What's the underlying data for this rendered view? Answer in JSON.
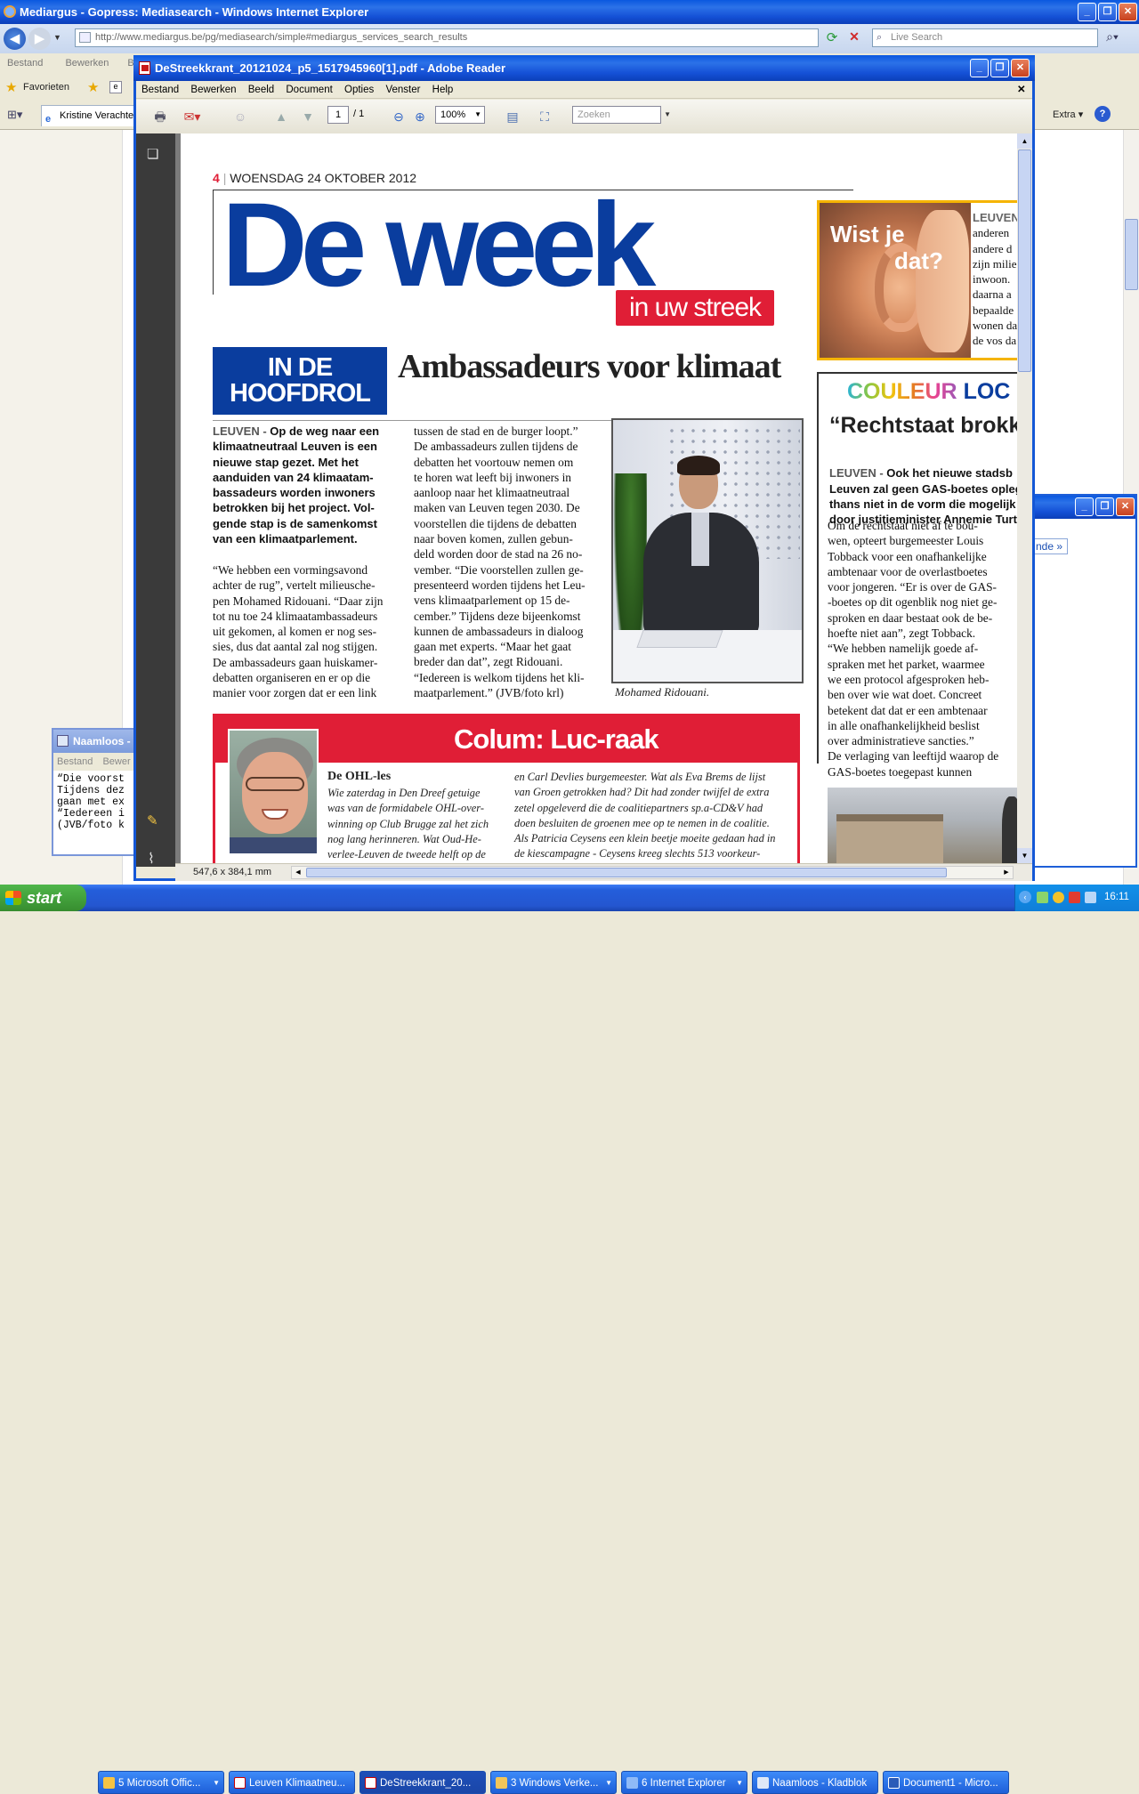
{
  "ie": {
    "title": "Mediargus - Gopress: Mediasearch - Windows Internet Explorer",
    "url": "http://www.mediargus.be/pg/mediasearch/simple#mediargus_services_search_results",
    "url_host": "www.mediargus.be",
    "search_placeholder": "Live Search",
    "menu": [
      "Bestand",
      "Bewerken",
      "Beel"
    ],
    "favorites_label": "Favorieten",
    "tab_label": "Kristine Verachter",
    "extra_label": "Extra",
    "side_link": "nde »"
  },
  "notepad": {
    "title": "Naamloos - ...",
    "menu": [
      "Bestand",
      "Bewer"
    ],
    "lines": [
      "“Die voorst",
      "Tijdens dez",
      "gaan met ex",
      "“Iedereen i",
      "(JVB/foto k"
    ]
  },
  "reader": {
    "title": "DeStreekkrant_20121024_p5_1517945960[1].pdf - Adobe Reader",
    "menu": [
      "Bestand",
      "Bewerken",
      "Beeld",
      "Document",
      "Opties",
      "Venster",
      "Help"
    ],
    "page_current": "1",
    "page_total": "/ 1",
    "zoom": "100%",
    "search_placeholder": "Zoeken",
    "status_size": "547,6 x 384,1 mm"
  },
  "newspaper": {
    "page_num": "4",
    "date": "WOENSDAG 24 OKTOBER 2012",
    "masthead": "De week",
    "masthead_sub": "in uw streek",
    "wist_title_1": "Wist je",
    "wist_title_2": "dat?",
    "wist_lines": [
      "LEUVEN",
      "anderen",
      "andere d",
      "zijn milie",
      "inwoon.",
      "daarna a",
      "bepaalde",
      "wonen da",
      "de vos da"
    ],
    "hoofdrol_1": "IN DE",
    "hoofdrol_2": "HOOFDROL",
    "headline": "Ambassadeurs voor klimaat",
    "lead_city": "LEUVEN -",
    "lead": "Op de weg naar een\nklimaatneutraal Leuven is een\nnieuwe stap gezet. Met het\naanduiden van 24 klimaatam-\nbassadeurs worden inwoners\nbetrokken bij het project. Vol-\ngende stap is de samenkomst\nvan een klimaatparlement.",
    "col1": "“We hebben een vormingsavond\nachter de rug”, vertelt milieusche-\npen Mohamed Ridouani. “Daar zijn\ntot nu toe 24 klimaatambassadeurs\nuit gekomen, al komen er nog ses-\nsies, dus dat aantal zal nog stijgen.\nDe ambassadeurs gaan huiskamer-\ndebatten organiseren en er op die\nmanier voor zorgen dat er een link",
    "col2": "tussen de stad en de burger loopt.”\nDe ambassadeurs zullen tijdens de\ndebatten het voortouw nemen om\nte horen wat leeft bij inwoners in\naanloop naar het klimaatneutraal\nmaken van Leuven tegen 2030. De\nvoorstellen die tijdens de debatten\nnaar boven komen, zullen gebun-\ndeld worden door de stad na 26 no-\nvember. “Die voorstellen zullen ge-\npresenteerd worden tijdens het Leu-\nvens klimaatparlement op 15 de-\ncember.” Tijdens deze bijeenkomst\nkunnen de ambassadeurs in dialoog\ngaan met experts. “Maar het gaat\nbreder dan dat”, zegt Ridouani.\n“Iedereen is welkom tijdens het kli-\nmaatparlement.” (JVB/foto krl)",
    "photo_caption": "Mohamed Ridouani.",
    "couleur_a": "COULEUR",
    "couleur_b": "LOC",
    "couleur_headline": "“Rechtstaat brokk",
    "couleur_lead_city": "LEUVEN -",
    "couleur_lead": "Ook het nieuwe stadsb\nLeuven zal geen GAS-boetes opleg\nthans niet in de vorm die mogelijk\ndoor justitieminister Annemie Turt",
    "couleur_body": "Om de rechtstaat niet af te bou-\nwen, opteert burgemeester Louis\nTobback voor een onafhankelijke\nambtenaar voor de overlastboetes\nvoor jongeren. “Er is over de GAS-\n-boetes op dit ogenblik nog niet ge-\nsproken en daar bestaat ook de be-\nhoefte niet aan”, zegt Tobback.\n“We hebben namelijk goede af-\nspraken met het parket, waarmee\nwe een protocol afgesproken heb-\nben over wie wat doet. Concreet\nbetekent dat dat er een ambtenaar\nin alle onafhankelijkheid beslist\nover administratieve sancties.”\nDe verlaging van leeftijd waarop de\nGAS-boetes toegepast kunnen",
    "colum_title": "Colum: Luc-raak",
    "colum_sub": "De OHL-les",
    "colum_c1": "Wie zaterdag in Den Dreef getuige\nwas van de formidabele OHL-over-\nwinning op Club Brugge zal het zich\nnog lang herinneren. Wat Oud-He-\nverlee-Leuven de tweede helft op de",
    "colum_c2": "en Carl Devlies burgemeester. Wat als Eva Brems de lijst\nvan Groen getrokken had? Dit had zonder twijfel de extra\nzetel opgeleverd die de coalitiepartners sp.a-CD&V had\ndoen besluiten de groenen mee op te nemen in de coalitie.\nAls Patricia Ceysens een klein beetje moeite gedaan had in\nde kiescampagne - Ceysens kreeg slechts 513 voorkeur-"
  },
  "taskbar": {
    "start": "start",
    "items": [
      "5 Microsoft Offic...",
      "Leuven Klimaatneu...",
      "DeStreekkrant_20...",
      "3 Windows Verke...",
      "6 Internet Explorer",
      "Naamloos - Kladblok",
      "Document1 - Micro..."
    ],
    "clock": "16:11"
  },
  "colors": {
    "masthead_blue": "#0a3d9e",
    "accent_red": "#e01e36",
    "wist_gold": "#f5b400"
  }
}
